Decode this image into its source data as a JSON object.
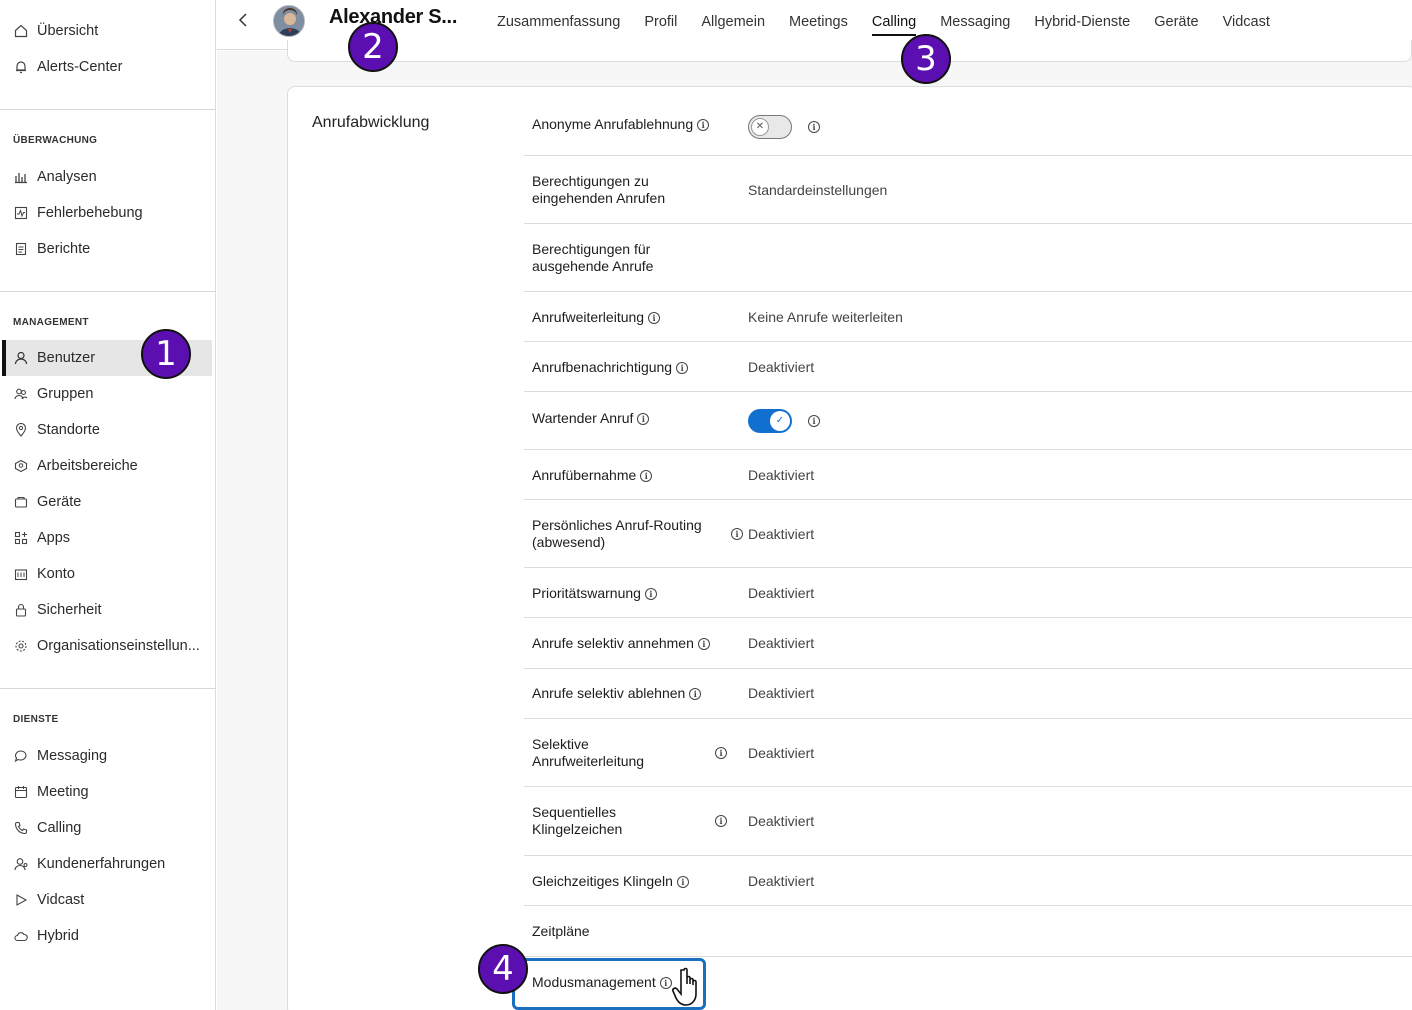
{
  "sidebar": {
    "top_items": [
      {
        "label": "Übersicht",
        "icon": "home-icon"
      },
      {
        "label": "Alerts-Center",
        "icon": "bell-icon"
      }
    ],
    "sections": [
      {
        "title": "ÜBERWACHUNG",
        "items": [
          {
            "label": "Analysen",
            "icon": "bar-chart-icon"
          },
          {
            "label": "Fehlerbehebung",
            "icon": "pulse-icon"
          },
          {
            "label": "Berichte",
            "icon": "document-icon"
          }
        ]
      },
      {
        "title": "MANAGEMENT",
        "items": [
          {
            "label": "Benutzer",
            "icon": "user-icon",
            "active": true
          },
          {
            "label": "Gruppen",
            "icon": "group-icon"
          },
          {
            "label": "Standorte",
            "icon": "location-pin-icon"
          },
          {
            "label": "Arbeitsbereiche",
            "icon": "workspace-icon"
          },
          {
            "label": "Geräte",
            "icon": "device-icon"
          },
          {
            "label": "Apps",
            "icon": "apps-icon"
          },
          {
            "label": "Konto",
            "icon": "building-icon"
          },
          {
            "label": "Sicherheit",
            "icon": "lock-icon"
          },
          {
            "label": "Organisationseinstellun...",
            "icon": "gear-icon"
          }
        ]
      },
      {
        "title": "DIENSTE",
        "items": [
          {
            "label": "Messaging",
            "icon": "chat-bubble-icon"
          },
          {
            "label": "Meeting",
            "icon": "calendar-icon"
          },
          {
            "label": "Calling",
            "icon": "phone-icon"
          },
          {
            "label": "Kundenerfahrungen",
            "icon": "customer-icon"
          },
          {
            "label": "Vidcast",
            "icon": "play-icon"
          },
          {
            "label": "Hybrid",
            "icon": "cloud-icon"
          }
        ]
      }
    ]
  },
  "header": {
    "user_name": "Alexander S...",
    "tabs": [
      "Zusammenfassung",
      "Profil",
      "Allgemein",
      "Meetings",
      "Calling",
      "Messaging",
      "Hybrid-Dienste",
      "Geräte",
      "Vidcast"
    ],
    "active_tab": "Calling"
  },
  "section": {
    "title": "Anrufabwicklung",
    "rows": [
      {
        "label": "Anonyme Anrufablehnung",
        "info": true,
        "toggle": "off"
      },
      {
        "label": "Berechtigungen zu eingehenden Anrufen",
        "value": "Standardeinstellungen"
      },
      {
        "label": "Berechtigungen für ausgehende Anrufe",
        "value": ""
      },
      {
        "label": "Anrufweiterleitung",
        "info": true,
        "value": "Keine Anrufe weiterleiten"
      },
      {
        "label": "Anrufbenachrichtigung",
        "info": true,
        "value": "Deaktiviert"
      },
      {
        "label": "Wartender Anruf",
        "info": true,
        "toggle": "on"
      },
      {
        "label": "Anrufübernahme",
        "info": true,
        "value": "Deaktiviert"
      },
      {
        "label": "Persönliches Anruf-Routing (abwesend)",
        "info": true,
        "value": "Deaktiviert"
      },
      {
        "label": "Prioritätswarnung",
        "info": true,
        "value": "Deaktiviert"
      },
      {
        "label": "Anrufe selektiv annehmen",
        "info": true,
        "value": "Deaktiviert"
      },
      {
        "label": "Anrufe selektiv ablehnen",
        "info": true,
        "value": "Deaktiviert"
      },
      {
        "label": "Selektive Anrufweiterleitung",
        "info": true,
        "value": "Deaktiviert"
      },
      {
        "label": "Sequentielles Klingelzeichen",
        "info": true,
        "value": "Deaktiviert"
      },
      {
        "label": "Gleichzeitiges Klingeln",
        "info": true,
        "value": "Deaktiviert"
      },
      {
        "label": "Zeitpläne",
        "value": ""
      },
      {
        "label": "Modusmanagement",
        "info": true,
        "value": ""
      }
    ]
  },
  "annotations": [
    "1",
    "2",
    "3",
    "4"
  ],
  "colors": {
    "accent": "#1170cf",
    "badge": "#5c0fb0",
    "highlight": "#1b6fbf"
  }
}
